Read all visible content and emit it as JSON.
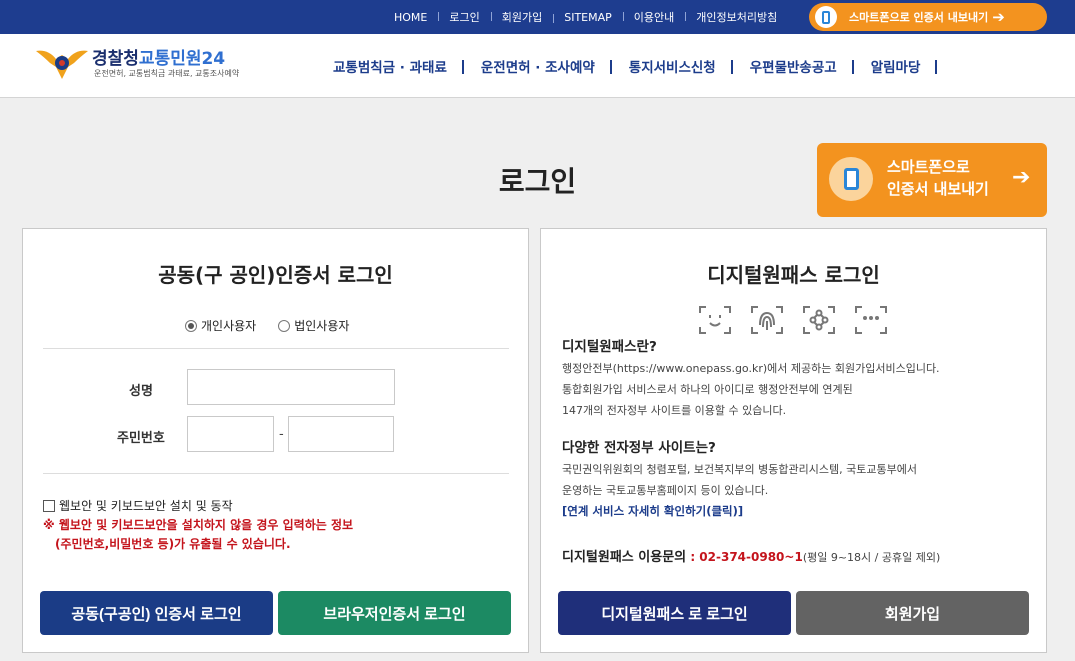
{
  "topbar": {
    "links": [
      "HOME",
      "로그인",
      "회원가입",
      "SITEMAP",
      "이용안내",
      "개인정보처리방침"
    ],
    "smart_label": "스마트폰으로 인증서 내보내기",
    "arrow": "➔",
    "color": "#1e3d8f"
  },
  "header": {
    "logo_main": "경찰청",
    "logo_accent": "교통민원24",
    "logo_sub": "운전면허, 교통범칙금 과태료, 교통조사예약",
    "nav": [
      "교통범칙금 · 과태료",
      "운전면허 · 조사예약",
      "통지서비스신청",
      "우편물반송공고",
      "알림마당"
    ]
  },
  "page": {
    "title": "로그인",
    "smart_line1": "스마트폰으로",
    "smart_line2": "인증서 내보내기",
    "arrow": "➔",
    "accent": "#f3931f"
  },
  "cert": {
    "title": "공동(구 공인)인증서 로그인",
    "radio_personal": "개인사용자",
    "radio_corp": "법인사용자",
    "name_label": "성명",
    "rrn_label": "주민번호",
    "rrn_sep": "-",
    "checkbox_label": "웹보안 및 키보드보안 설치 및 동작",
    "warning_line1": "※ 웹보안 및 키보드보안을 설치하지 않을 경우 입력하는 정보",
    "warning_line2": "(주민번호,비밀번호 등)가 유출될 수 있습니다.",
    "btn_cert": "공동(구공인) 인증서 로그인",
    "btn_browser": "브라우저인증서 로그인"
  },
  "onepass": {
    "title": "디지털원패스 로그인",
    "icons": [
      "face-id-icon",
      "fingerprint-icon",
      "pattern-icon",
      "pin-icon"
    ],
    "what_title": "디지털원패스란?",
    "what_line1": "행정안전부(https://www.onepass.go.kr)에서 제공하는 회원가입서비스입니다.",
    "what_line2": "통합회원가입 서비스로서 하나의 아이디로 행정안전부에 연계된",
    "what_line3": "147개의 전자정부 사이트를 이용할 수 있습니다.",
    "sites_title": "다양한 전자정부 사이트는?",
    "sites_line1": "국민권익위원회의 청렴포털, 보건복지부의 병동합관리시스템, 국토교통부에서",
    "sites_line2": "운영하는 국토교통부홈페이지 등이 있습니다.",
    "link": "[연계 서비스 자세히 확인하기(클릭)]",
    "inquiry_label": "디지털원패스 이용문의",
    "inquiry_colon": " : ",
    "inquiry_tel": "02-374-0980~1",
    "inquiry_hours": "(평일 9~18시 / 공휴일 제외)",
    "btn_login": "디지털원패스 로 로그인",
    "btn_join": "회원가입"
  }
}
